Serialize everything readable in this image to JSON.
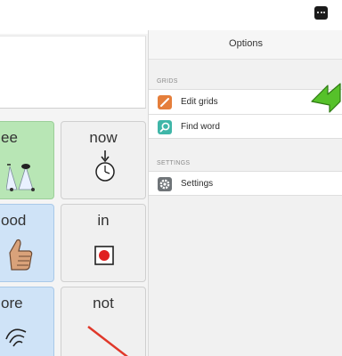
{
  "panel": {
    "title": "Options",
    "sections": [
      {
        "label": "GRIDS",
        "items": [
          {
            "label": "Edit grids",
            "icon": "pencil-icon"
          },
          {
            "label": "Find word",
            "icon": "magnifier-icon"
          }
        ]
      },
      {
        "label": "SETTINGS",
        "items": [
          {
            "label": "Settings",
            "icon": "gear-icon"
          }
        ]
      }
    ]
  },
  "grid": {
    "cells": [
      {
        "word": "ee",
        "symbol": "eyes-symbol"
      },
      {
        "word": "now",
        "symbol": "stopwatch-symbol"
      },
      {
        "word": "ood",
        "symbol": "thumbs-up-symbol"
      },
      {
        "word": "in",
        "symbol": "box-with-dot-symbol"
      },
      {
        "word": "ore",
        "symbol": "more-symbol"
      },
      {
        "word": "not",
        "symbol": "red-line-symbol"
      }
    ]
  },
  "colors": {
    "accent_arrow": "#56c12a",
    "edit_icon": "#e57e3b",
    "find_icon": "#3fb6a8",
    "settings_icon": "#6f7478",
    "cell_green": "#b8e6b5",
    "cell_blue": "#cfe3f7"
  }
}
